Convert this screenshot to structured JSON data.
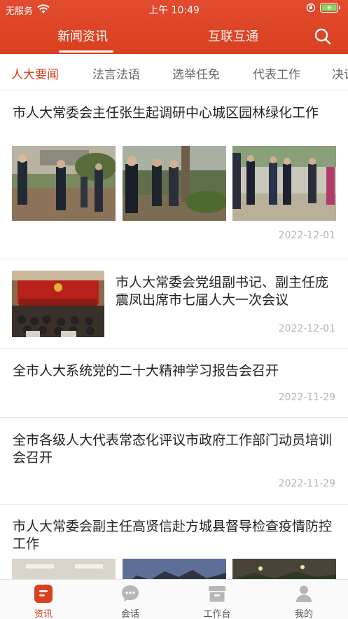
{
  "status_bar": {
    "carrier": "无服务",
    "time": "上午 10:49"
  },
  "top_nav": {
    "tabs": [
      {
        "label": "新闻资讯",
        "active": true
      },
      {
        "label": "互联互通",
        "active": false
      }
    ],
    "search_icon": "search-icon"
  },
  "categories": [
    {
      "label": "人大要闻",
      "active": true
    },
    {
      "label": "法言法语",
      "active": false
    },
    {
      "label": "选举任免",
      "active": false
    },
    {
      "label": "代表工作",
      "active": false
    },
    {
      "label": "决议",
      "active": false
    }
  ],
  "articles": [
    {
      "title": "市人大常委会主任张生起调研中心城区园林绿化工作",
      "date": "2022-12-01",
      "layout": "three-images"
    },
    {
      "title": "市人大常委会党组副书记、副主任庞震凤出席市七届人大一次会议",
      "date": "2022-12-01",
      "layout": "left-image"
    },
    {
      "title": "全市人大系统党的二十大精神学习报告会召开",
      "date": "2022-11-29",
      "layout": "text"
    },
    {
      "title": "全市各级人大代表常态化评议市政府工作部门动员培训会召开",
      "date": "2022-11-29",
      "layout": "text"
    },
    {
      "title": "市人大常委会副主任高贤信赴方城县督导检查疫情防控工作",
      "date": "",
      "layout": "three-images"
    }
  ],
  "bottom_nav": [
    {
      "label": "资讯",
      "icon": "news-icon",
      "active": true
    },
    {
      "label": "会话",
      "icon": "chat-icon",
      "active": false
    },
    {
      "label": "工作台",
      "icon": "workbench-icon",
      "active": false
    },
    {
      "label": "我的",
      "icon": "profile-icon",
      "active": false
    }
  ],
  "colors": {
    "brand": "#d8401f",
    "inactive_text": "#666666",
    "date_text": "#b5b5b5"
  }
}
